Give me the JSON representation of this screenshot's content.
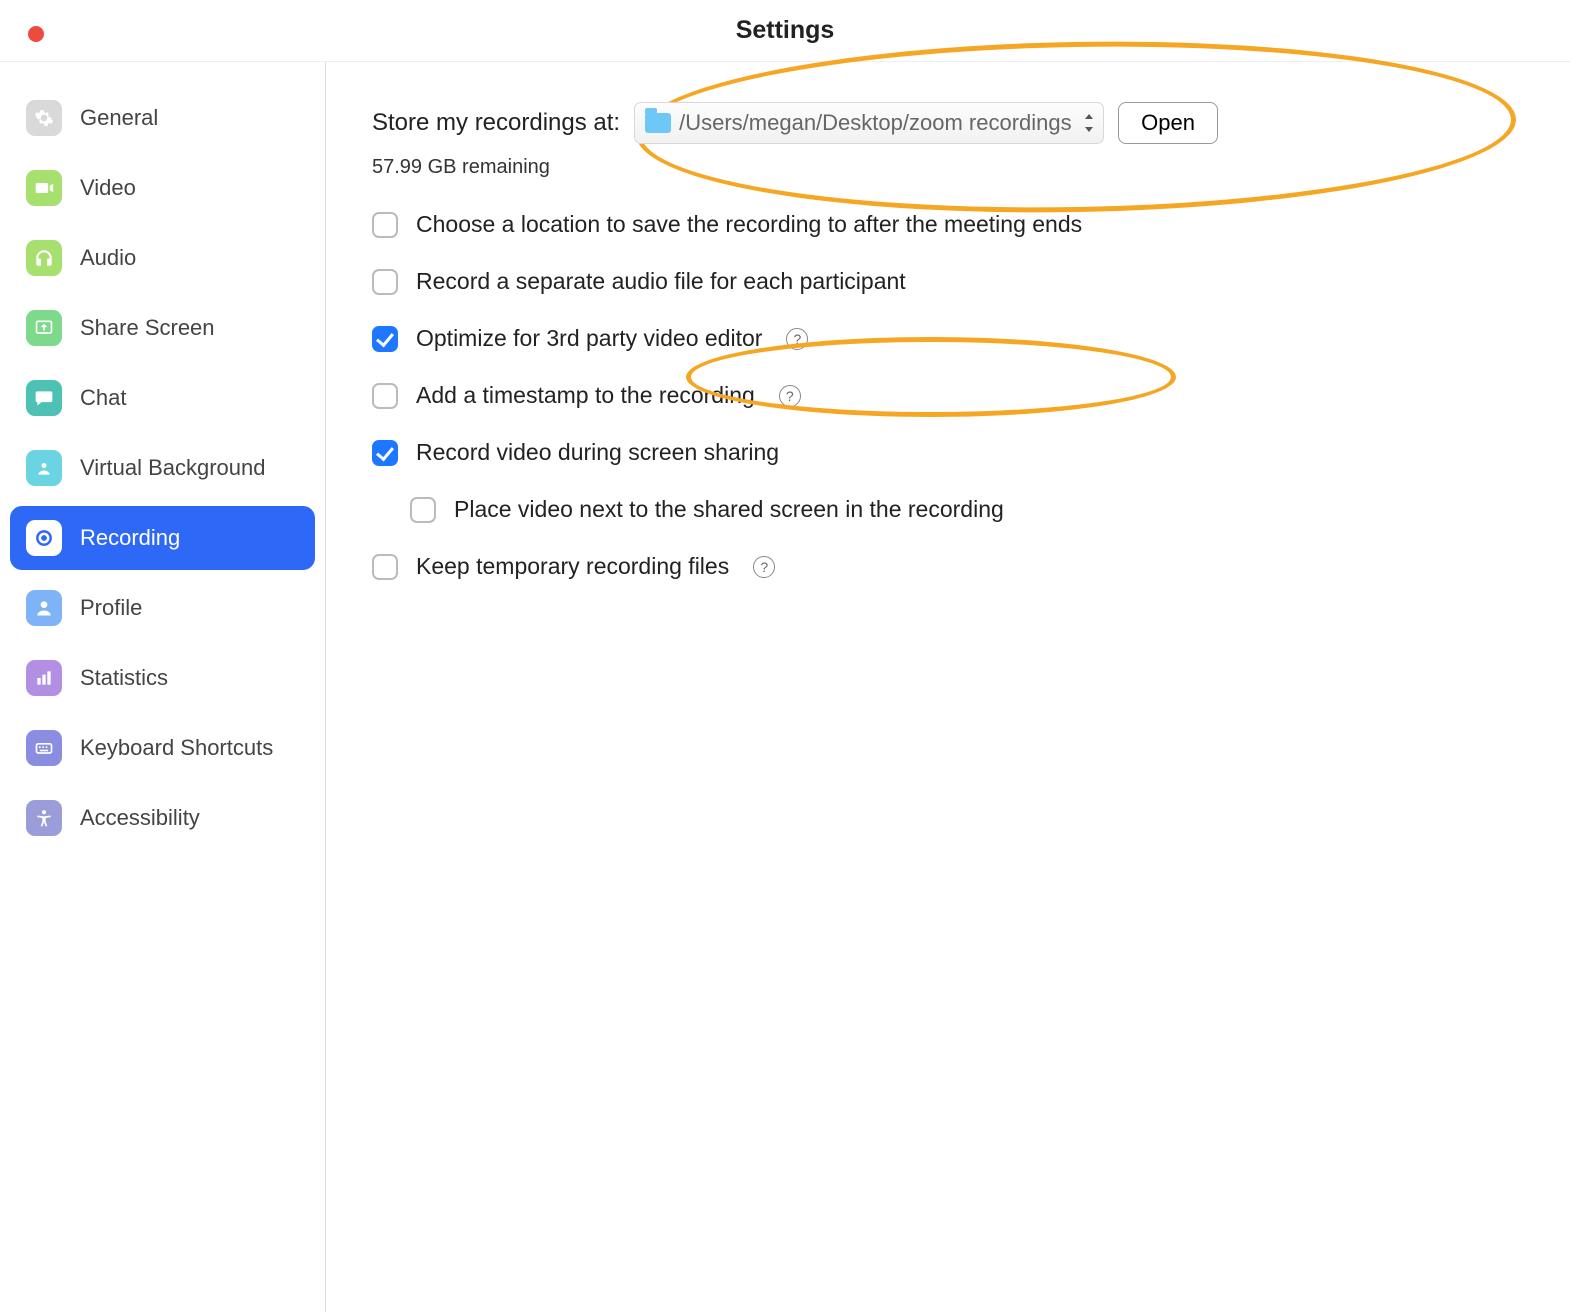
{
  "window": {
    "title": "Settings"
  },
  "sidebar": {
    "items": [
      {
        "label": "General"
      },
      {
        "label": "Video"
      },
      {
        "label": "Audio"
      },
      {
        "label": "Share Screen"
      },
      {
        "label": "Chat"
      },
      {
        "label": "Virtual Background"
      },
      {
        "label": "Recording"
      },
      {
        "label": "Profile"
      },
      {
        "label": "Statistics"
      },
      {
        "label": "Keyboard Shortcuts"
      },
      {
        "label": "Accessibility"
      }
    ],
    "active_index": 6
  },
  "recording": {
    "store_label": "Store my recordings at:",
    "path": "/Users/megan/Desktop/zoom recordings",
    "open_label": "Open",
    "remaining": "57.99 GB remaining",
    "options": [
      {
        "label": "Choose a location to save the recording to after the meeting ends",
        "checked": false,
        "help": false,
        "sub": false
      },
      {
        "label": "Record a separate audio file for each participant",
        "checked": false,
        "help": false,
        "sub": false
      },
      {
        "label": "Optimize for 3rd party video editor",
        "checked": true,
        "help": true,
        "sub": false
      },
      {
        "label": "Add a timestamp to the recording",
        "checked": false,
        "help": true,
        "sub": false
      },
      {
        "label": "Record video during screen sharing",
        "checked": true,
        "help": false,
        "sub": false
      },
      {
        "label": "Place video next to the shared screen in the recording",
        "checked": false,
        "help": false,
        "sub": true
      },
      {
        "label": "Keep temporary recording files",
        "checked": false,
        "help": true,
        "sub": false
      }
    ]
  },
  "colors": {
    "accent": "#2D68F6",
    "annotation": "#f5a623"
  }
}
